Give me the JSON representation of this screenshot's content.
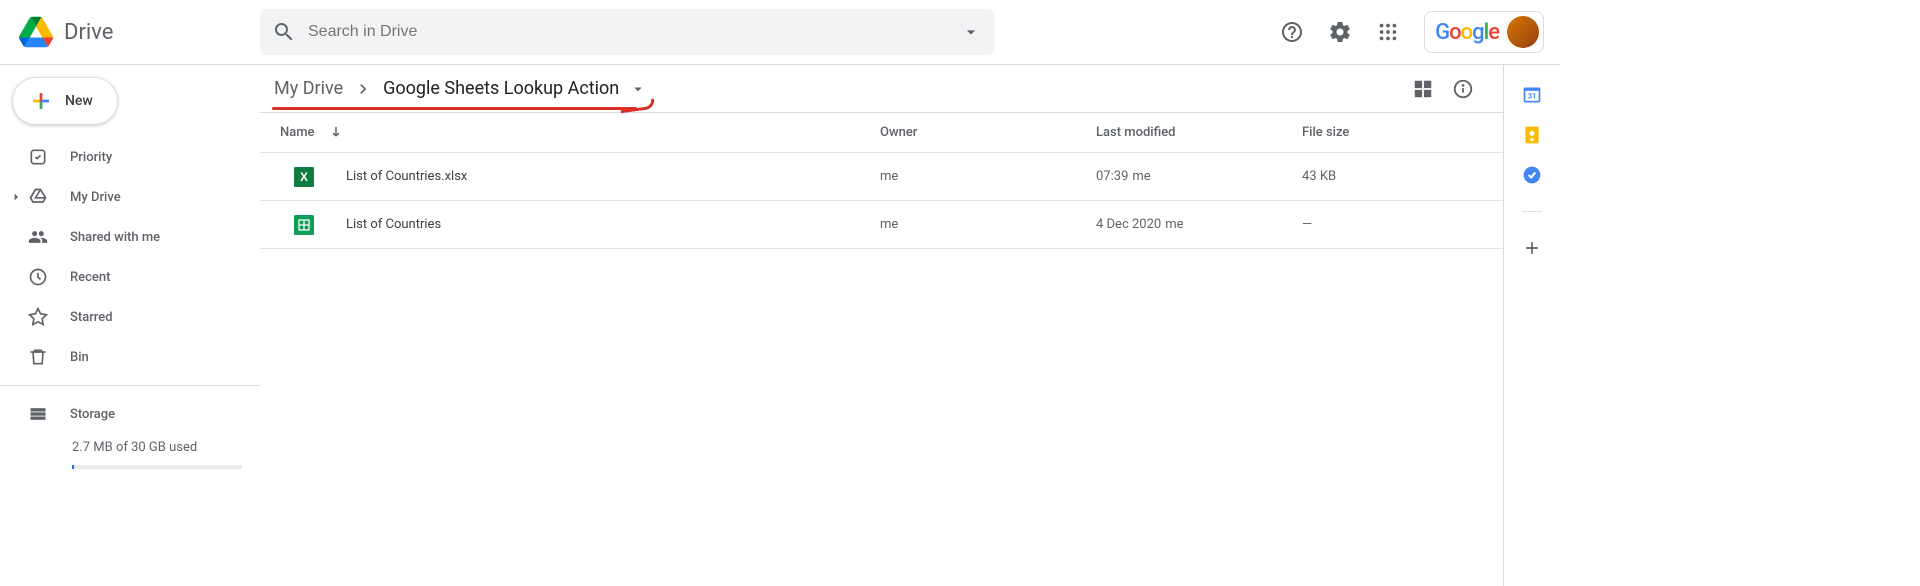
{
  "header": {
    "app_name": "Drive",
    "search_placeholder": "Search in Drive",
    "google_logo_text": "Google"
  },
  "sidebar": {
    "new_label": "New",
    "items": [
      {
        "label": "Priority"
      },
      {
        "label": "My Drive"
      },
      {
        "label": "Shared with me"
      },
      {
        "label": "Recent"
      },
      {
        "label": "Starred"
      },
      {
        "label": "Bin"
      }
    ],
    "storage_label": "Storage",
    "storage_usage": "2.7 MB of 30 GB used"
  },
  "breadcrumb": {
    "root": "My Drive",
    "current": "Google Sheets Lookup Action"
  },
  "columns": {
    "name": "Name",
    "owner": "Owner",
    "modified": "Last modified",
    "size": "File size"
  },
  "files": [
    {
      "name": "List of Countries.xlsx",
      "owner": "me",
      "modified": "07:39",
      "modified_by": "me",
      "size": "43 KB",
      "type": "excel"
    },
    {
      "name": "List of Countries",
      "owner": "me",
      "modified": "4 Dec 2020",
      "modified_by": "me",
      "size": "—",
      "type": "sheets"
    }
  ]
}
